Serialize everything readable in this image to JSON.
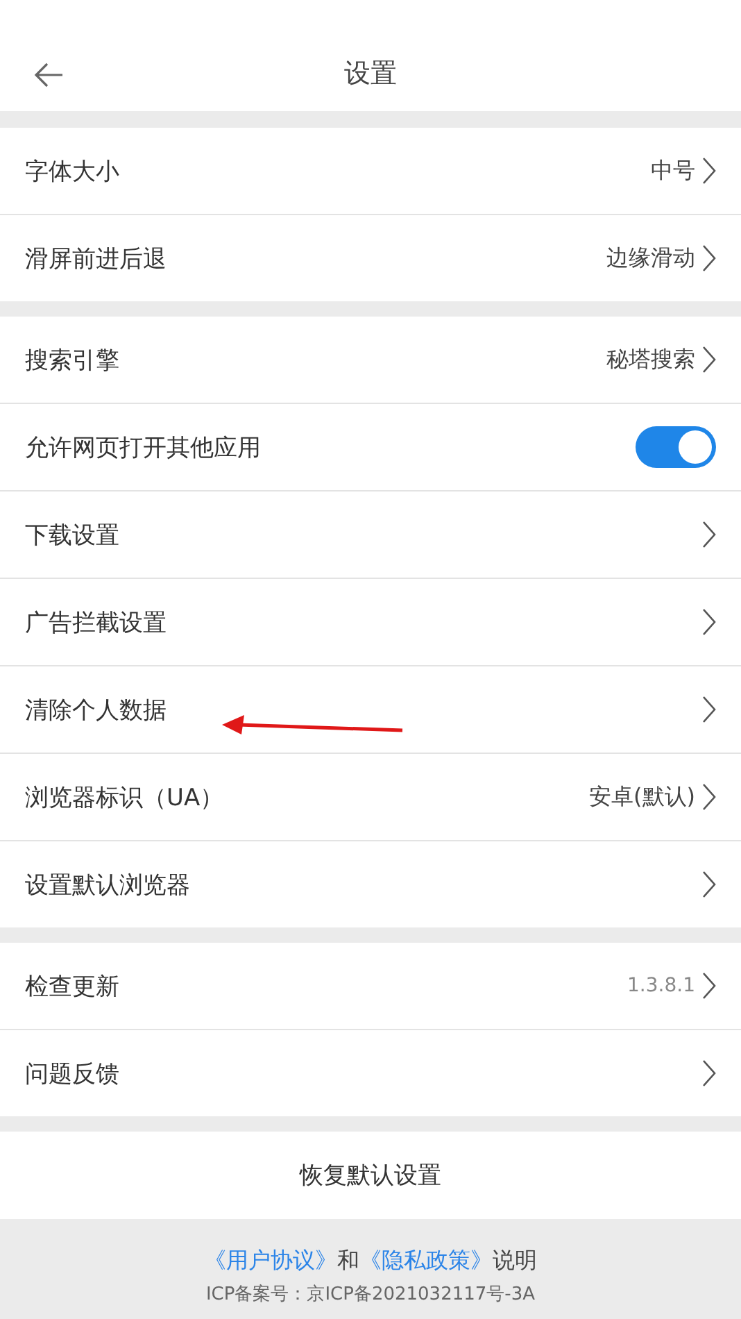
{
  "header": {
    "title": "设置"
  },
  "groups": [
    [
      {
        "kind": "nav",
        "label": "字体大小",
        "value": "中号"
      },
      {
        "kind": "nav",
        "label": "滑屏前进后退",
        "value": "边缘滑动"
      }
    ],
    [
      {
        "kind": "nav",
        "label": "搜索引擎",
        "value": "秘塔搜索"
      },
      {
        "kind": "toggle",
        "label": "允许网页打开其他应用",
        "on": true
      },
      {
        "kind": "nav",
        "label": "下载设置"
      },
      {
        "kind": "nav",
        "label": "广告拦截设置"
      },
      {
        "kind": "nav",
        "label": "清除个人数据"
      },
      {
        "kind": "nav",
        "label": "浏览器标识（UA）",
        "value": "安卓(默认)"
      },
      {
        "kind": "nav",
        "label": "设置默认浏览器"
      }
    ],
    [
      {
        "kind": "nav",
        "label": "检查更新",
        "value": "1.3.8.1",
        "small": true
      },
      {
        "kind": "nav",
        "label": "问题反馈"
      }
    ]
  ],
  "restore_button": "恢复默认设置",
  "footer": {
    "user_agreement": "《用户协议》",
    "and": "和",
    "privacy_policy": "《隐私政策》",
    "explanation": "说明",
    "icp": "ICP备案号：京ICP备2021032117号-3A"
  }
}
